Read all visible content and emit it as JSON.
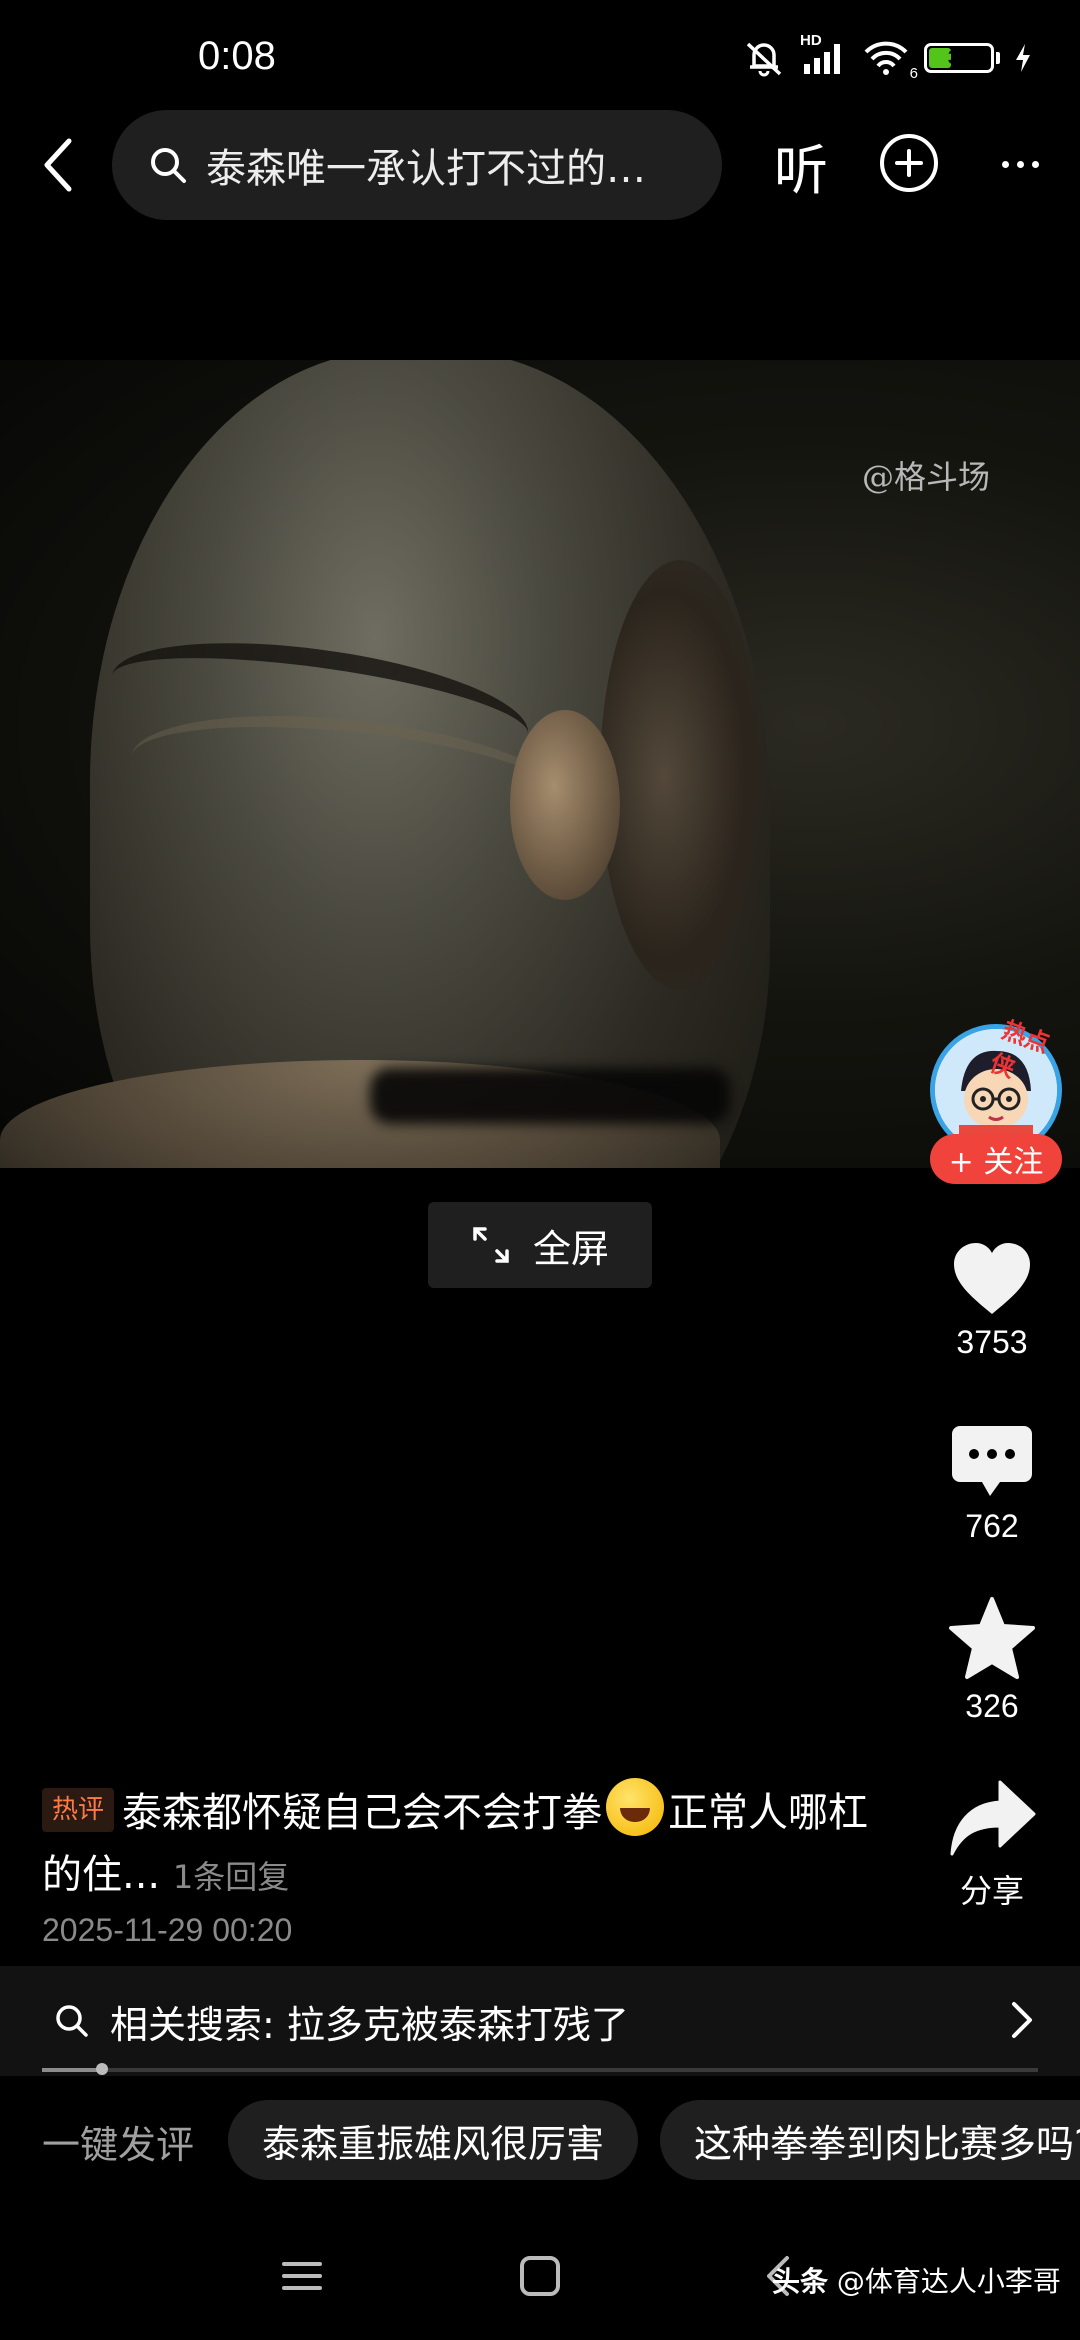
{
  "status_bar": {
    "time": "0:08",
    "signal_label": "HD",
    "wifi_label": "6",
    "battery_percent": "36",
    "battery_level": 0.36
  },
  "header": {
    "search_text": "泰森唯一承认打不过的…",
    "listen_label": "听"
  },
  "video": {
    "watermark": "@格斗场",
    "fullscreen_label": "全屏"
  },
  "rail": {
    "avatar_badge": "热点侠",
    "follow_label": "+ 关注",
    "likes": "3753",
    "comments": "762",
    "favorites": "326",
    "share_label": "分享"
  },
  "hot_comment": {
    "tag": "热评",
    "text_part1": "泰森都怀疑自己会不会打拳",
    "text_part2": "正常人哪杠的住...",
    "reply_count": "1条回复",
    "date": "2025-11-29 00:20"
  },
  "related_search": {
    "label": "相关搜索: 拉多克被泰森打残了",
    "progress": 0.06
  },
  "quick_comment": {
    "label": "一键发评",
    "chips": [
      "泰森重振雄风很厉害",
      "这种拳拳到肉比赛多吗?"
    ]
  },
  "footer": {
    "source_brand": "头条",
    "source_user": "@体育达人小李哥"
  },
  "colors": {
    "accent_red": "#f0433b",
    "battery_green": "#52c41a",
    "hot_tag_orange": "#ff7a45"
  }
}
